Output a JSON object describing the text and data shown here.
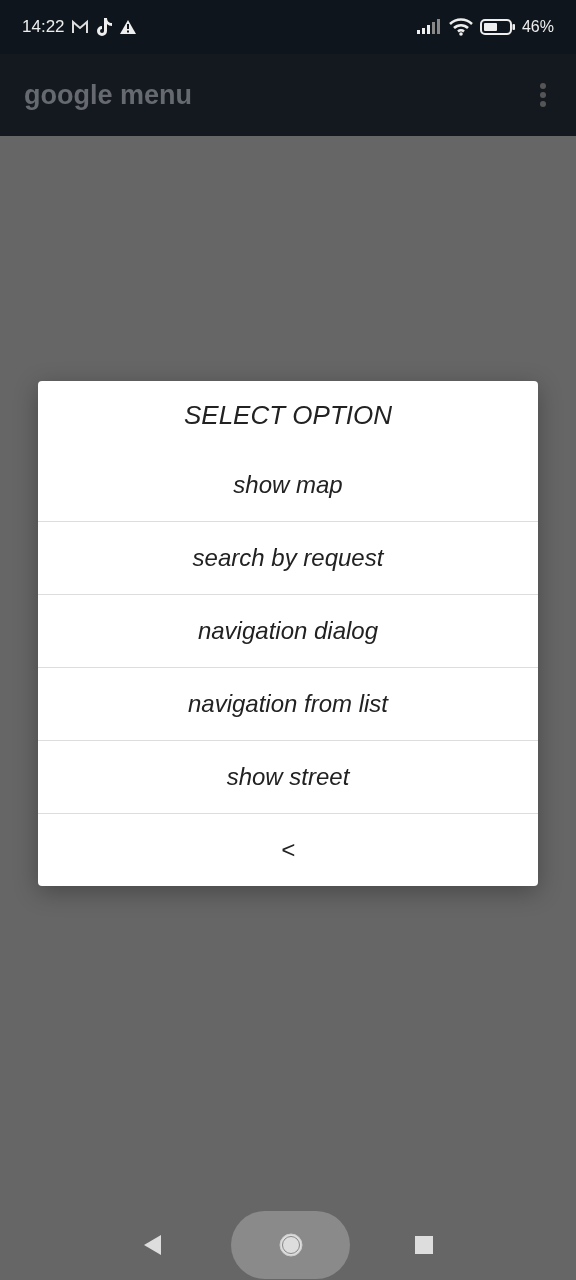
{
  "status_bar": {
    "time": "14:22",
    "battery": "46%"
  },
  "app_bar": {
    "title": "google menu"
  },
  "dialog": {
    "title": "SELECT OPTION",
    "items": [
      {
        "label": "show map"
      },
      {
        "label": "search by request"
      },
      {
        "label": "navigation dialog"
      },
      {
        "label": "navigation from list"
      },
      {
        "label": "show street"
      },
      {
        "label": "<"
      }
    ]
  }
}
